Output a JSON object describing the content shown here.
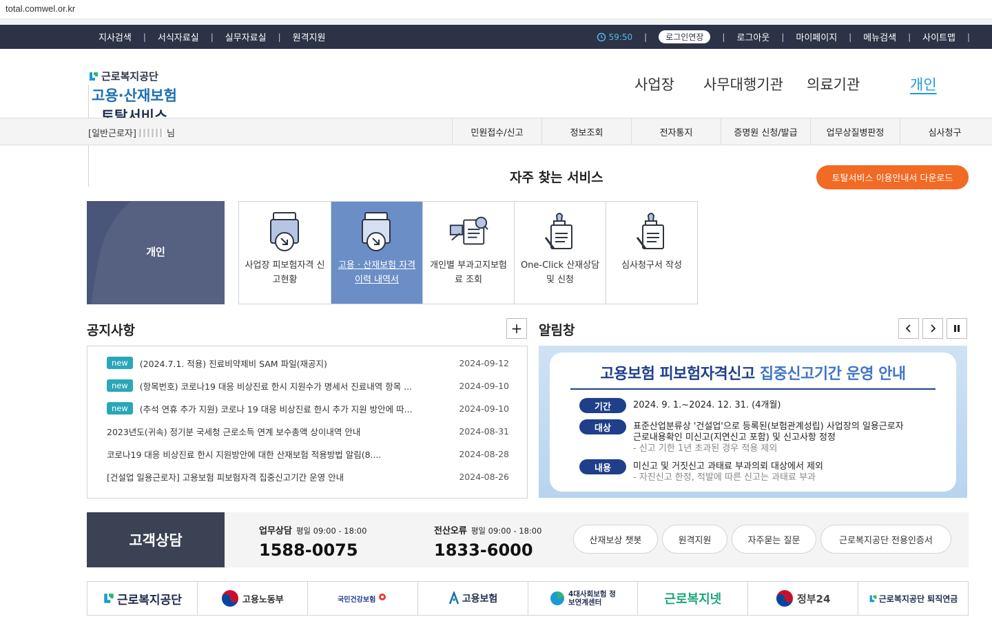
{
  "browser": {
    "url": "total.comwel.or.kr"
  },
  "topbar": {
    "left_links": [
      "지사검색",
      "서식자료실",
      "실무자료실",
      "원격지원"
    ],
    "timer": "59:50",
    "extend_label": "로그인연장",
    "right_links": [
      "로그아웃",
      "마이페이지",
      "메뉴검색",
      "사이트맵"
    ]
  },
  "header": {
    "org_name": "근로복지공단",
    "service_blue": "고용·산재보험",
    "service_dark": "토탈서비스",
    "nav": [
      "사업장",
      "사무대행기관",
      "의료기관",
      "개인"
    ],
    "active_nav": "개인"
  },
  "subnav": {
    "user_type": "[일반근로자]",
    "user_suffix": "님",
    "menus": [
      "민원접수/신고",
      "정보조회",
      "전자통지",
      "증명원 신청/발급",
      "업무상질병판정",
      "심사청구"
    ]
  },
  "services": {
    "title": "자주 찾는 서비스",
    "guide_button": "토탈서비스 이용안내서 다운로드",
    "category": "개인",
    "items": [
      {
        "label": "사업장 피보험자격 신고현황",
        "icon": "document-down-icon"
      },
      {
        "label": "고용 · 산재보험 자격 이력 내역서",
        "icon": "document-down-icon"
      },
      {
        "label": "개인별 부과고지보험료 조회",
        "icon": "search-document-icon"
      },
      {
        "label": "One-Click 산재상담 및 신청",
        "icon": "stamp-document-icon"
      },
      {
        "label": "심사청구서 작성",
        "icon": "stamp-document-icon"
      }
    ]
  },
  "notices": {
    "title": "공지사항",
    "more_label": "+",
    "items": [
      {
        "badge": "new",
        "title": "(2024.7.1. 적용) 진료비약제비 SAM 파일(재공지)",
        "date": "2024-09-12"
      },
      {
        "badge": "new",
        "title": "(항목번호) 코로나19 대응 비상진료 한시 지원수가 명세서 진료내역 항목 ...",
        "date": "2024-09-10"
      },
      {
        "badge": "new",
        "title": "(추석 연휴 추가 지원) 코로나 19 대응 비상진료 한시 추가 지원 방안에 따...",
        "date": "2024-09-10"
      },
      {
        "badge": "",
        "title": "2023년도(귀속) 정기분 국세청 근로소득 연계 보수총액 상이내역 안내",
        "date": "2024-08-31"
      },
      {
        "badge": "",
        "title": "코로나19 대응 비상진료 한시 지원방안에 대한 산재보험 적용방법 알림(8....",
        "date": "2024-08-28"
      },
      {
        "badge": "",
        "title": "[건설업 일용근로자] 고용보험 피보험자격 집중신고기간 운영 안내",
        "date": "2024-08-26"
      }
    ]
  },
  "alerts": {
    "title": "알림창",
    "banner": {
      "heading_main": "고용보험 피보험자격신고",
      "heading_sub": "집중신고기간 운영 안내",
      "rows": [
        {
          "label": "기간",
          "lines": [
            "2024. 9. 1.~2024. 12. 31. (4개월)"
          ],
          "note": ""
        },
        {
          "label": "대상",
          "lines": [
            "표준산업분류상 '건설업'으로 등록된(보험관계성립) 사업장의 일용근로자",
            "근로내용확인 미신고(지연신고 포함) 및 신고사항 정정"
          ],
          "note": "- 신고 기한 1년 초과된 경우 적용 제외"
        },
        {
          "label": "내용",
          "lines": [
            "미신고 및 거짓신고 과태료 부과의뢰 대상에서 제외"
          ],
          "note": "- 자진신고 한정, 적발에 따른 신고는 과태료 부과"
        }
      ]
    }
  },
  "customer": {
    "title": "고객상담",
    "business": {
      "label": "업무상담",
      "hours": "평일 09:00 - 18:00",
      "phone": "1588-0075"
    },
    "it": {
      "label": "전산오류",
      "hours": "평일 09:00 - 18:00",
      "phone": "1833-6000"
    },
    "buttons": [
      "산재보상 챗봇",
      "원격지원",
      "자주묻는 질문",
      "근로복지공단 전용인증서"
    ]
  },
  "footer_links": [
    "근로복지공단",
    "고용노동부",
    "국민건강보험",
    "고용보험",
    "4대사회보험 정보연계센터",
    "근로복지넷",
    "정부24",
    "근로복지공단 퇴직연금"
  ],
  "colors": {
    "dark_navy": "#2c3346",
    "accent_orange": "#f26a23",
    "accent_blue": "#1e9bd7",
    "badge_teal": "#2aa7b8",
    "selected_tile": "#6b8ec7"
  }
}
